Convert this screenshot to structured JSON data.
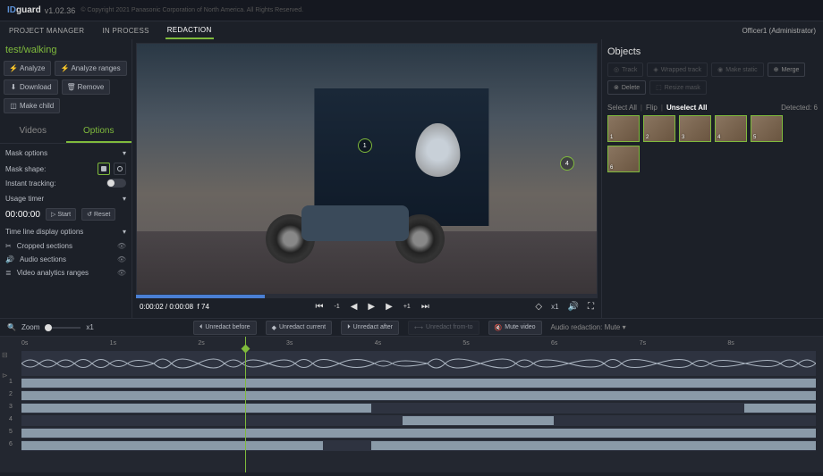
{
  "header": {
    "logo_prefix": "ID",
    "logo": "guard",
    "version": "v1.02.36",
    "copyright": "© Copyright 2021 Panasonic Corporation of North America. All Rights Reserved."
  },
  "nav": {
    "items": [
      "PROJECT MANAGER",
      "IN PROCESS",
      "REDACTION"
    ],
    "active": 2,
    "user": "Officer1 (Administrator)"
  },
  "project": {
    "name": "test/walking",
    "buttons": {
      "analyze": "Analyze",
      "analyze_ranges": "Analyze ranges",
      "download": "Download",
      "remove": "Remove",
      "make_child": "Make child"
    }
  },
  "tabs": {
    "videos": "Videos",
    "options": "Options",
    "active": "options"
  },
  "options": {
    "mask_options": "Mask options",
    "mask_shape_label": "Mask shape:",
    "instant_tracking_label": "Instant tracking:",
    "usage_timer": "Usage timer",
    "timer_value": "00:00:00",
    "start_btn": "Start",
    "reset_btn": "Reset",
    "timeline_display": "Time line display options",
    "display_items": {
      "cropped": "Cropped sections",
      "audio": "Audio sections",
      "analytics": "Video analytics ranges"
    }
  },
  "player": {
    "current": "0:00:02",
    "total": "0:00:08",
    "frame_label": "f",
    "frame": "74",
    "back_step": "-1",
    "fwd_step": "+1",
    "speed": "x1",
    "markers": [
      "1",
      "4"
    ]
  },
  "objects": {
    "title": "Objects",
    "buttons": {
      "track": "Track",
      "wrapped": "Wrapped track",
      "static": "Make static",
      "merge": "Merge",
      "delete": "Delete",
      "resize": "Resize mask"
    },
    "select_all": "Select All",
    "flip": "Flip",
    "unselect_all": "Unselect All",
    "detected_label": "Detected:",
    "detected_count": "6",
    "thumbs": [
      "1",
      "2",
      "3",
      "4",
      "5",
      "6"
    ]
  },
  "toolbar": {
    "zoom_label": "Zoom",
    "zoom_value": "x1",
    "unredact_before": "Unredact before",
    "unredact_current": "Unredact current",
    "unredact_after": "Unredact after",
    "unredact_from_to": "Unredact from-to",
    "mute_video": "Mute video",
    "audio_redaction": "Audio redaction:",
    "audio_mode": "Mute"
  },
  "timeline": {
    "ticks": [
      "0s",
      "1s",
      "2s",
      "3s",
      "4s",
      "5s",
      "6s",
      "7s",
      "8s"
    ],
    "tracks": [
      "1",
      "2",
      "3",
      "4",
      "5",
      "6"
    ],
    "playhead_pct": 28,
    "segments": {
      "1": [
        [
          0,
          100
        ]
      ],
      "2": [
        [
          0,
          100
        ]
      ],
      "3": [
        [
          0,
          44
        ],
        [
          91,
          100
        ]
      ],
      "4": [
        [
          48,
          67
        ]
      ],
      "5": [
        [
          0,
          100
        ]
      ],
      "6": [
        [
          0,
          38
        ],
        [
          44,
          100
        ]
      ]
    }
  }
}
